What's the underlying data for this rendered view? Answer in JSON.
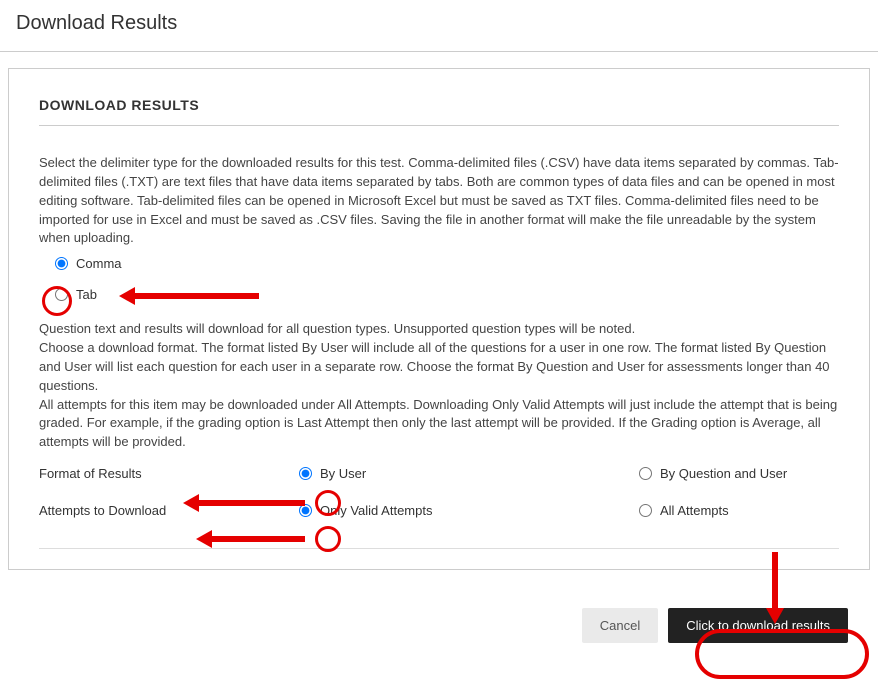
{
  "header": {
    "page_title": "Download Results"
  },
  "section": {
    "heading": "DOWNLOAD RESULTS",
    "delimiter_desc": "Select the delimiter type for the downloaded results for this test. Comma-delimited files (.CSV) have data items separated by commas. Tab-delimited files (.TXT) are text files that have data items separated by tabs. Both are common types of data files and can be opened in most editing software. Tab-delimited files can be opened in Microsoft Excel but must be saved as TXT files. Comma-delimited files need to be imported for use in Excel and must be saved as .CSV files. Saving the file in another format will make the file unreadable by the system when uploading.",
    "radio_comma": "Comma",
    "radio_tab": "Tab",
    "format_desc_1": "Question text and results will download for all question types. Unsupported question types will be noted.",
    "format_desc_2": "Choose a download format. The format listed By User will include all of the questions for a user in one row. The format listed By Question and User will list each question for each user in a separate row. Choose the format By Question and User for assessments longer than 40 questions.",
    "format_desc_3": "All attempts for this item may be downloaded under All Attempts. Downloading Only Valid Attempts will just include the attempt that is being graded. For example, if the grading option is Last Attempt then only the last attempt will be provided. If the Grading option is Average, all attempts will be provided.",
    "format_row_label": "Format of Results",
    "format_by_user": "By User",
    "format_by_question": "By Question and User",
    "attempts_row_label": "Attempts to Download",
    "attempts_valid": "Only Valid Attempts",
    "attempts_all": "All Attempts"
  },
  "buttons": {
    "cancel": "Cancel",
    "download": "Click to download results"
  }
}
